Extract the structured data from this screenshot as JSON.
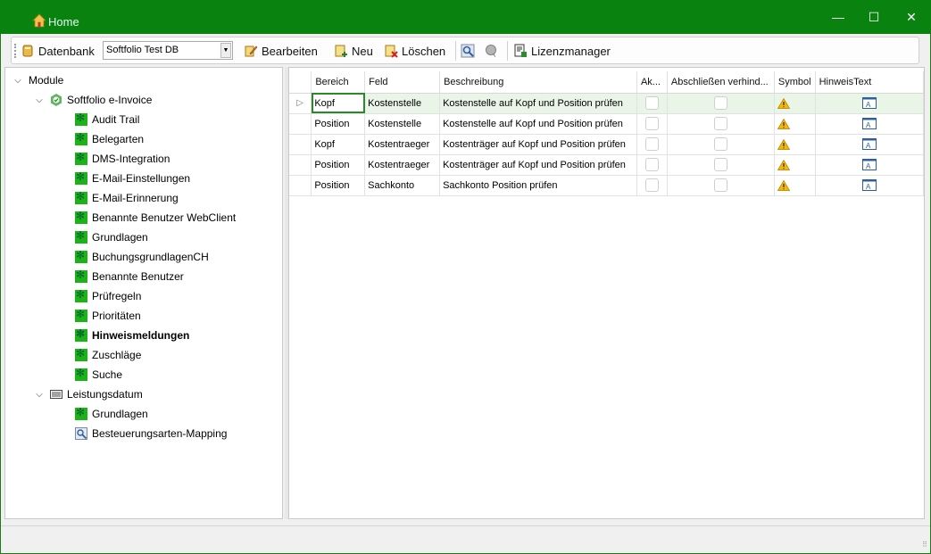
{
  "window": {
    "title": "Home",
    "minimize_glyph": "—",
    "maximize_glyph": "☐",
    "close_glyph": "✕"
  },
  "toolbar": {
    "database_label": "Datenbank",
    "database_value": "Softfolio Test DB",
    "edit_label": "Bearbeiten",
    "new_label": "Neu",
    "delete_label": "Löschen",
    "license_label": "Lizenzmanager"
  },
  "tree": {
    "root": "Module",
    "softfolio": "Softfolio e-Invoice",
    "items": [
      "Audit Trail",
      "Belegarten",
      "DMS-Integration",
      "E-Mail-Einstellungen",
      "E-Mail-Erinnerung",
      "Benannte Benutzer WebClient",
      "Grundlagen",
      "BuchungsgrundlagenCH",
      "Benannte Benutzer",
      "Prüfregeln",
      "Prioritäten",
      "Hinweismeldungen",
      "Zuschläge",
      "Suche"
    ],
    "selected": "Hinweismeldungen",
    "leistungsdatum": "Leistungsdatum",
    "ld_items": [
      "Grundlagen",
      "Besteuerungsarten-Mapping"
    ]
  },
  "grid": {
    "columns": [
      "Bereich",
      "Feld",
      "Beschreibung",
      "Ak...",
      "Abschließen verhind...",
      "Symbol",
      "HinweisText"
    ],
    "rows": [
      {
        "bereich": "Kopf",
        "feld": "Kostenstelle",
        "beschreibung": "Kostenstelle auf Kopf und Position prüfen",
        "aktiv": false,
        "abschliessen": false
      },
      {
        "bereich": "Position",
        "feld": "Kostenstelle",
        "beschreibung": "Kostenstelle auf Kopf und Position prüfen",
        "aktiv": false,
        "abschliessen": false
      },
      {
        "bereich": "Kopf",
        "feld": "Kostentraeger",
        "beschreibung": "Kostenträger auf Kopf und Position prüfen",
        "aktiv": false,
        "abschliessen": false
      },
      {
        "bereich": "Position",
        "feld": "Kostentraeger",
        "beschreibung": "Kostenträger auf Kopf und Position prüfen",
        "aktiv": false,
        "abschliessen": false
      },
      {
        "bereich": "Position",
        "feld": "Sachkonto",
        "beschreibung": "Sachkonto Position prüfen",
        "aktiv": false,
        "abschliessen": false
      }
    ],
    "current_row_indicator": "▷",
    "symbol_icon": "warning-icon",
    "hinweis_icon": "text-note-icon"
  },
  "colors": {
    "titlebar": "#0a8210",
    "selected_row": "#e9f5e6",
    "focus_outline": "#2a8a2a",
    "gear_icon": "#1db318"
  }
}
